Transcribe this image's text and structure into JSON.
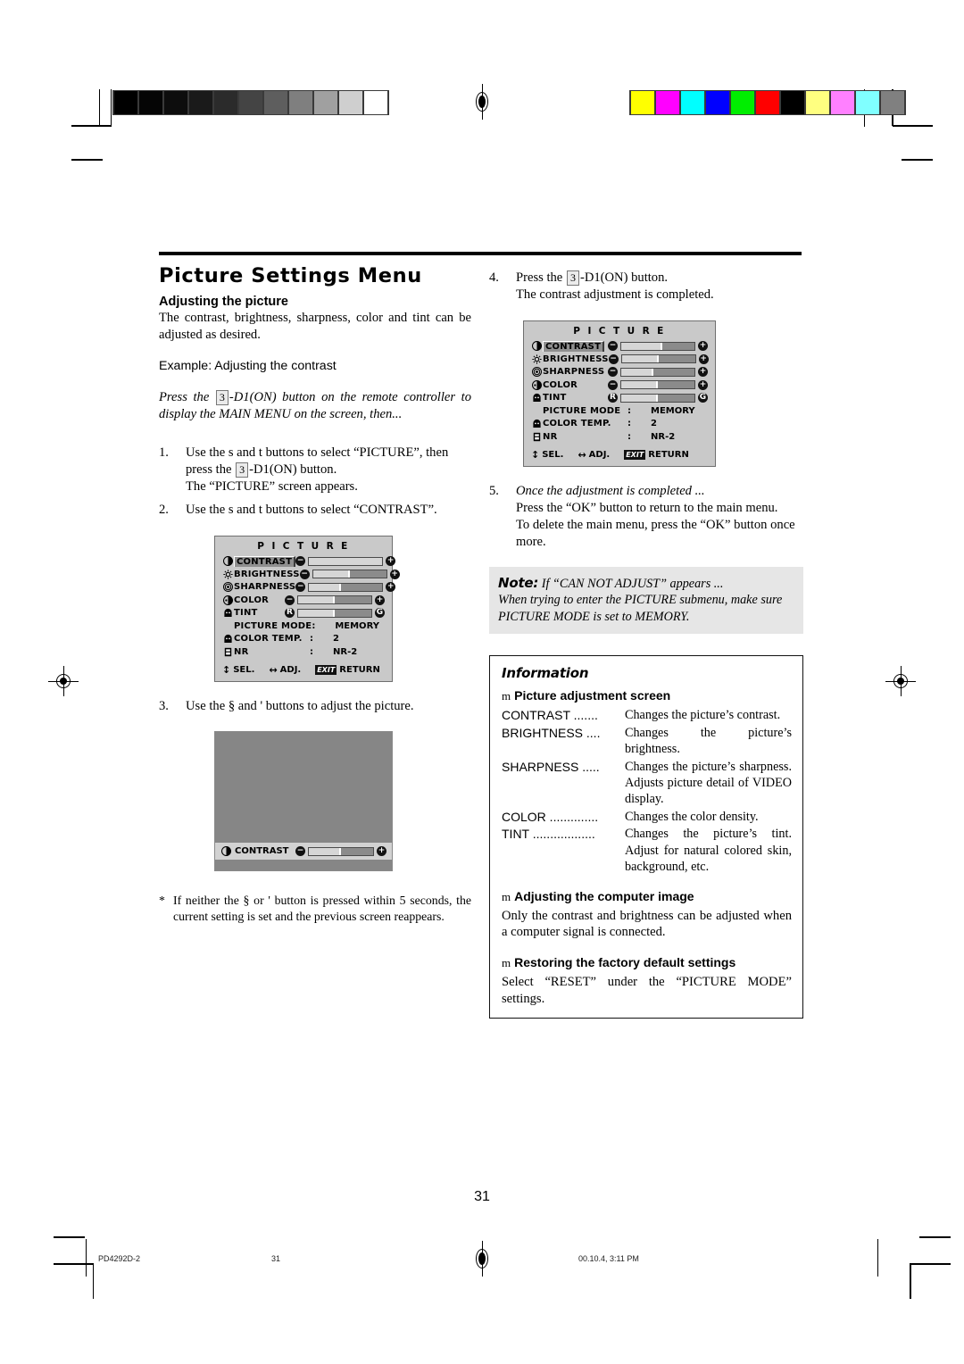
{
  "document": {
    "title": "Picture Settings Menu",
    "page_number": "31"
  },
  "marks": {
    "gray_bar_colors": [
      "#000000",
      "#050505",
      "#0d0d0d",
      "#1a1a1a",
      "#2b2b2b",
      "#444444",
      "#5e5e5e",
      "#7f7f7f",
      "#a0a0a0",
      "#cfcfcf",
      "#ffffff"
    ],
    "color_bar_colors": [
      "#ffff00",
      "#ff00ff",
      "#00ffff",
      "#0000ff",
      "#00ee00",
      "#ff0000",
      "#000000",
      "#ffff80",
      "#ff80ff",
      "#80ffff",
      "#808080"
    ]
  },
  "left_column": {
    "heading": "Adjusting the picture",
    "intro": "The contrast, brightness, sharpness, color and tint can be adjusted as desired.",
    "example": "Example: Adjusting the contrast",
    "press_intro_a": "Press the",
    "press_key": "3",
    "press_intro_b": "-D1(ON) button on the remote controller to display the MAIN MENU on the screen, then...",
    "steps": [
      {
        "num": "1.",
        "parts": [
          "Use the ",
          "s",
          "  and ",
          "t",
          "   buttons to select “PICTURE”, then press the ",
          "KEY3",
          "-D1(ON) button.",
          "The “PICTURE” screen appears."
        ],
        "line1": "Use the s  and t   buttons to select “PICTURE”, then press the",
        "line2": "-D1(ON) button.",
        "line3": "The “PICTURE” screen appears."
      },
      {
        "num": "2.",
        "text": "Use the s  and t   buttons to select “CONTRAST”."
      },
      {
        "num": "3.",
        "text": "Use the §  and '   buttons to adjust the picture."
      }
    ],
    "footnote": {
      "star": "*",
      "text": "If neither the §  or '   button is pressed within 5 seconds, the current setting is set and the previous screen reappears."
    }
  },
  "right_column": {
    "step4": {
      "num": "4.",
      "line1_a": "Press the",
      "key": "3",
      "line1_b": "-D1(ON) button.",
      "line2": "The contrast adjustment is completed."
    },
    "step5": {
      "num": "5.",
      "line1": "Once the adjustment is completed ...",
      "line2": "Press the “OK” button to return to the main menu.",
      "line3": "To delete the main menu, press the “OK” button once more."
    },
    "note": {
      "label": "Note:",
      "line1": "If “CAN NOT ADJUST” appears ...",
      "line2": "When trying to enter the PICTURE submenu, make sure PICTURE MODE is set to MEMORY."
    },
    "information": {
      "title": "Information",
      "sections": [
        {
          "bullet": "m",
          "heading": "Picture adjustment screen",
          "definitions": [
            {
              "term": "CONTRAST .......",
              "desc": "Changes the picture’s contrast."
            },
            {
              "term": "BRIGHTNESS ....",
              "desc": "Changes the picture’s brightness."
            },
            {
              "term": "SHARPNESS .....",
              "desc": "Changes the picture’s sharpness. Adjusts picture detail of VIDEO display."
            },
            {
              "term": "COLOR ..............",
              "desc": "Changes the color density."
            },
            {
              "term": "TINT ..................",
              "desc": "Changes the picture’s tint. Adjust for natural colored skin, background, etc."
            }
          ]
        },
        {
          "bullet": "m",
          "heading": "Adjusting the computer image",
          "body": "Only the contrast and brightness can be adjusted when a computer signal is connected."
        },
        {
          "bullet": "m",
          "heading": "Restoring the factory default settings",
          "body": "Select “RESET” under the “PICTURE MODE” settings."
        }
      ]
    }
  },
  "osd_menu_left": {
    "title": "P I C T U R E",
    "sliders": [
      {
        "label": "CONTRAST",
        "icon": "contrast-icon",
        "selected": true,
        "left_mark": "➖",
        "right_mark": "➕",
        "fill_percent": 100
      },
      {
        "label": "BRIGHTNESS",
        "icon": "brightness-icon",
        "selected": false,
        "left_mark": "➖",
        "right_mark": "➕",
        "fill_percent": 50
      },
      {
        "label": "SHARPNESS",
        "icon": "sharpness-icon",
        "selected": false,
        "left_mark": "➖",
        "right_mark": "➕",
        "fill_percent": 44
      },
      {
        "label": "COLOR",
        "icon": "color-icon",
        "selected": false,
        "left_mark": "➖",
        "right_mark": "➕",
        "fill_percent": 50
      },
      {
        "label": "TINT",
        "icon": "tint-icon",
        "selected": false,
        "left_mark": "R",
        "right_mark": "G",
        "fill_percent": 50
      }
    ],
    "values": [
      {
        "label": "PICTURE MODE",
        "icon": "none",
        "colon": ":",
        "value": "MEMORY"
      },
      {
        "label": "COLOR TEMP.",
        "icon": "colortemp-icon",
        "colon": ":",
        "value": "2"
      },
      {
        "label": "NR",
        "icon": "nr-icon",
        "colon": ":",
        "value": "NR-2"
      }
    ],
    "footer": {
      "sel": "SEL.",
      "adj": "ADJ.",
      "exit": "EXIT",
      "return": "RETURN"
    }
  },
  "osd_menu_right": {
    "title": "P I C T U R E",
    "sliders": [
      {
        "label": "CONTRAST",
        "icon": "contrast-icon",
        "selected": true,
        "left_mark": "➖",
        "right_mark": "➕",
        "fill_percent": 56
      },
      {
        "label": "BRIGHTNESS",
        "icon": "brightness-icon",
        "selected": false,
        "left_mark": "➖",
        "right_mark": "➕",
        "fill_percent": 50
      },
      {
        "label": "SHARPNESS",
        "icon": "sharpness-icon",
        "selected": false,
        "left_mark": "➖",
        "right_mark": "➕",
        "fill_percent": 44
      },
      {
        "label": "COLOR",
        "icon": "color-icon",
        "selected": false,
        "left_mark": "➖",
        "right_mark": "➕",
        "fill_percent": 50
      },
      {
        "label": "TINT",
        "icon": "tint-icon",
        "selected": false,
        "left_mark": "R",
        "right_mark": "G",
        "fill_percent": 50
      }
    ],
    "values": [
      {
        "label": "PICTURE MODE",
        "icon": "none",
        "colon": ":",
        "value": "MEMORY"
      },
      {
        "label": "COLOR TEMP.",
        "icon": "colortemp-icon",
        "colon": ":",
        "value": "2"
      },
      {
        "label": "NR",
        "icon": "nr-icon",
        "colon": ":",
        "value": "NR-2"
      }
    ],
    "footer": {
      "sel": "SEL.",
      "adj": "ADJ.",
      "exit": "EXIT",
      "return": "RETURN"
    }
  },
  "contrast_screen": {
    "label": "CONTRAST",
    "icon": "contrast-icon",
    "left_mark": "➖",
    "right_mark": "➕",
    "fill_percent": 50
  },
  "footer": {
    "model": "PD4292D-2",
    "page": "31",
    "timestamp": "00.10.4, 3:11 PM"
  }
}
